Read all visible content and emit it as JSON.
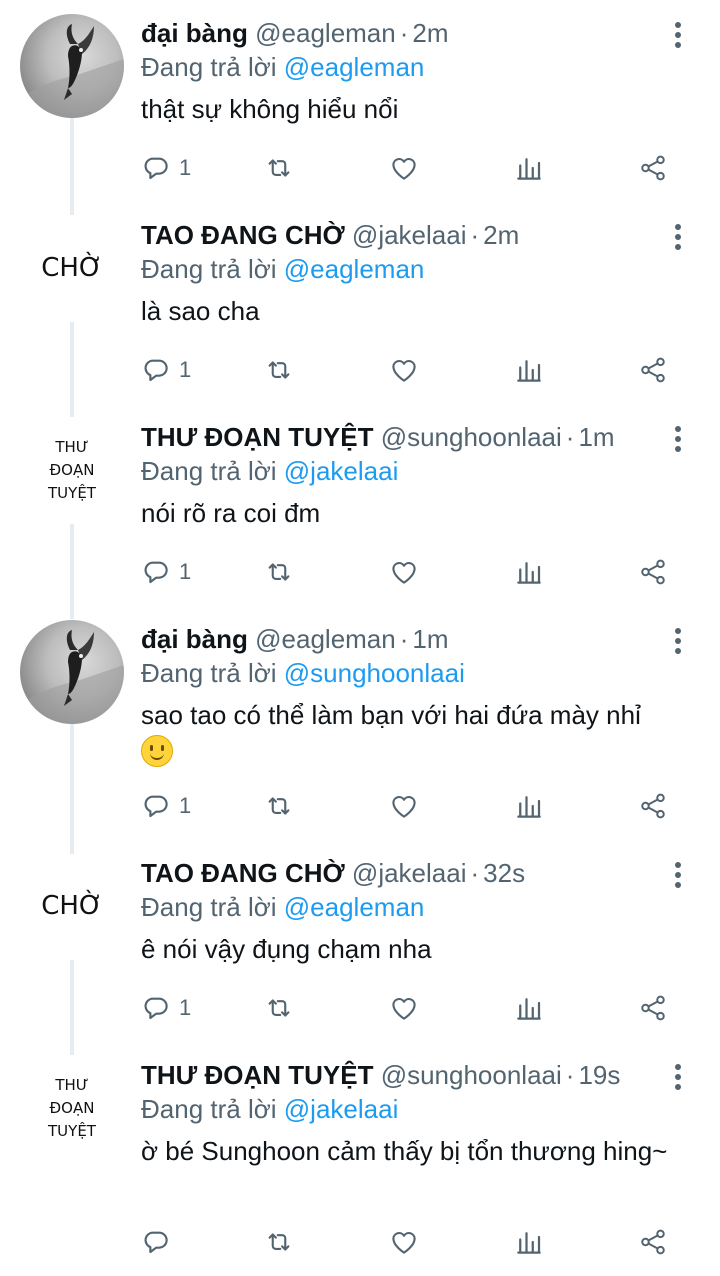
{
  "tweets": [
    {
      "avatar": {
        "kind": "photo",
        "icon": "eagle-photo"
      },
      "name": "đại bàng",
      "handle": "@eagleman",
      "dot": "·",
      "time": "2m",
      "replying_prefix": "Đang trả lời ",
      "replying_to": "@eagleman",
      "text": "thật sự không hiểu nổi",
      "emoji": "",
      "reply_count": "1"
    },
    {
      "avatar": {
        "kind": "text",
        "lines": [
          "CHỜ"
        ]
      },
      "name": "TAO ĐANG CHỜ",
      "handle": "@jakelaai",
      "dot": "·",
      "time": "2m",
      "replying_prefix": "Đang trả lời ",
      "replying_to": "@eagleman",
      "text": "là sao cha",
      "emoji": "",
      "reply_count": "1"
    },
    {
      "avatar": {
        "kind": "text",
        "lines": [
          "THƯ",
          "ĐOẠN",
          "TUYỆT"
        ]
      },
      "name": "THƯ ĐOẠN TUYỆT",
      "handle": "@sunghoonlaai",
      "dot": "·",
      "time": "1m",
      "replying_prefix": "Đang trả lời ",
      "replying_to": "@jakelaai",
      "text": "nói rõ ra coi đm",
      "emoji": "",
      "reply_count": "1"
    },
    {
      "avatar": {
        "kind": "photo",
        "icon": "eagle-photo"
      },
      "name": "đại bàng",
      "handle": "@eagleman",
      "dot": "·",
      "time": "1m",
      "replying_prefix": "Đang trả lời ",
      "replying_to": "@sunghoonlaai",
      "text": "sao tao có thể làm bạn với hai đứa mày nhỉ",
      "emoji": "slightly-smiling-face",
      "reply_count": "1"
    },
    {
      "avatar": {
        "kind": "text",
        "lines": [
          "CHỜ"
        ]
      },
      "name": "TAO ĐANG CHỜ",
      "handle": "@jakelaai",
      "dot": "·",
      "time": "32s",
      "replying_prefix": "Đang trả lời ",
      "replying_to": "@eagleman",
      "text": "ê nói vậy đụng chạm nha",
      "emoji": "",
      "reply_count": "1"
    },
    {
      "avatar": {
        "kind": "text",
        "lines": [
          "THƯ",
          "ĐOẠN",
          "TUYỆT"
        ]
      },
      "name": "THƯ ĐOẠN TUYỆT",
      "handle": "@sunghoonlaai",
      "dot": "·",
      "time": "19s",
      "replying_prefix": "Đang trả lời ",
      "replying_to": "@jakelaai",
      "text": "ờ bé Sunghoon cảm thấy bị tổn thương hing~",
      "emoji": "",
      "reply_count": ""
    }
  ],
  "icons": {
    "reply": "reply-icon",
    "retweet": "retweet-icon",
    "like": "heart-icon",
    "analytics": "analytics-icon",
    "share": "share-icon",
    "more": "more-vertical-icon"
  },
  "colors": {
    "mention": "#1d9bf0",
    "secondary": "#536471",
    "text": "#0f1419",
    "thread": "#e6ecf0"
  }
}
